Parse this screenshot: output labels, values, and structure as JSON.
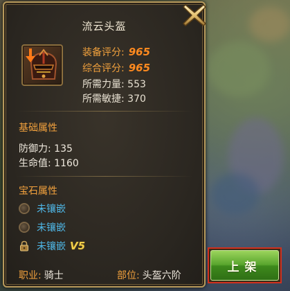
{
  "item": {
    "name": "流云头盔",
    "icon": "helmet-icon",
    "equip_score_label": "装备评分:",
    "equip_score_value": "965",
    "overall_score_label": "综合评分:",
    "overall_score_value": "965",
    "req_strength_label": "所需力量:",
    "req_strength_value": "553",
    "req_agility_label": "所需敏捷:",
    "req_agility_value": "370"
  },
  "basic_attributes": {
    "heading": "基础属性",
    "defense_label": "防御力:",
    "defense_value": "135",
    "hp_label": "生命值:",
    "hp_value": "1160"
  },
  "gem_attributes": {
    "heading": "宝石属性",
    "slots": [
      {
        "text": "未镶嵌",
        "locked": false
      },
      {
        "text": "未镶嵌",
        "locked": false
      },
      {
        "text": "未镶嵌",
        "locked": true,
        "vip": "V5"
      }
    ]
  },
  "footer": {
    "class_label": "职业:",
    "class_value": "骑士",
    "slot_label": "部位:",
    "slot_value": "头盔六阶"
  },
  "buttons": {
    "list_label": "上架",
    "close_icon": "close-icon"
  },
  "colors": {
    "accent_orange": "#f2a13d",
    "score_orange": "#ff8a1f",
    "gem_blue": "#4fb8e8",
    "button_green": "#58a52d",
    "highlight_red": "#d0301e"
  }
}
